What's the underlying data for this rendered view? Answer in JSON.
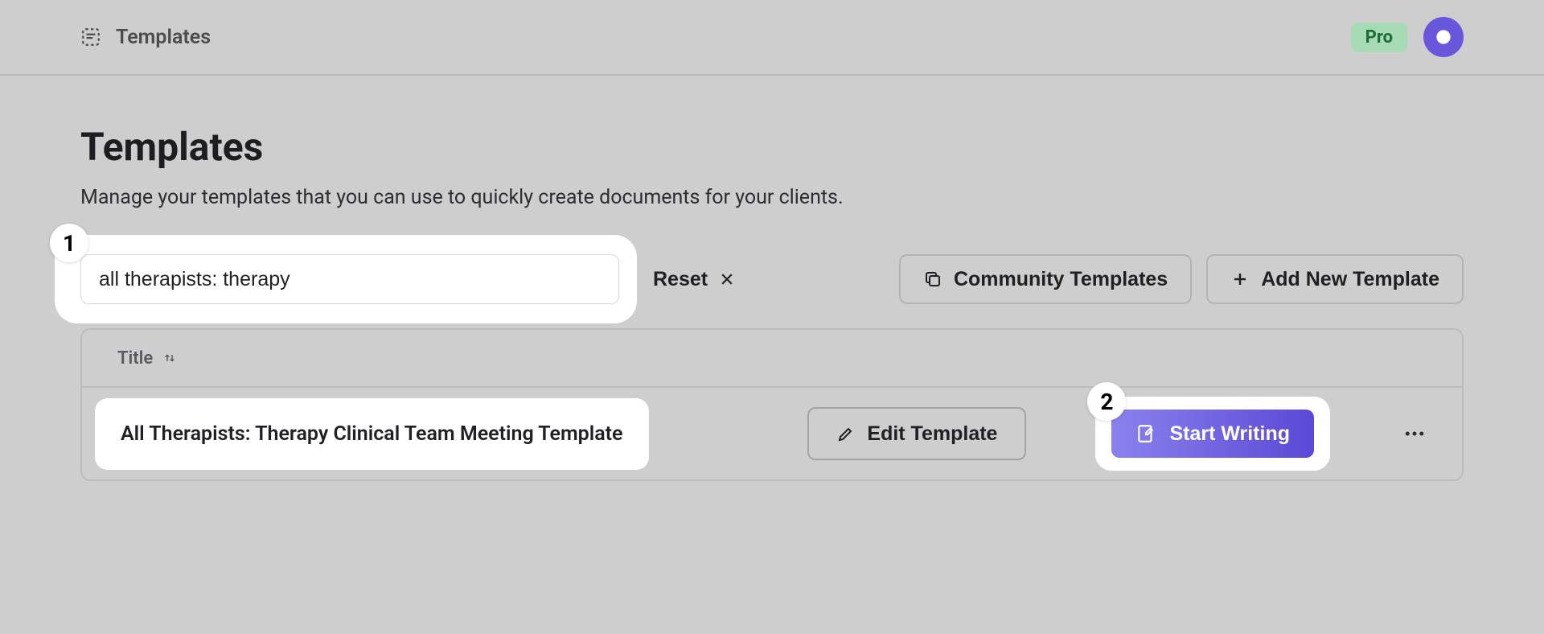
{
  "header": {
    "breadcrumb_label": "Templates",
    "pro_badge": "Pro"
  },
  "page": {
    "title": "Templates",
    "subtitle": "Manage your templates that you can use to quickly create documents for your clients."
  },
  "toolbar": {
    "search_value": "all therapists: therapy",
    "reset_label": "Reset",
    "community_label": "Community Templates",
    "add_new_label": "Add New Template"
  },
  "table": {
    "header_title": "Title",
    "rows": [
      {
        "title": "All Therapists: Therapy Clinical Team Meeting Template",
        "edit_label": "Edit Template",
        "start_label": "Start Writing"
      }
    ]
  },
  "annotations": {
    "badge1": "1",
    "badge2": "2"
  }
}
